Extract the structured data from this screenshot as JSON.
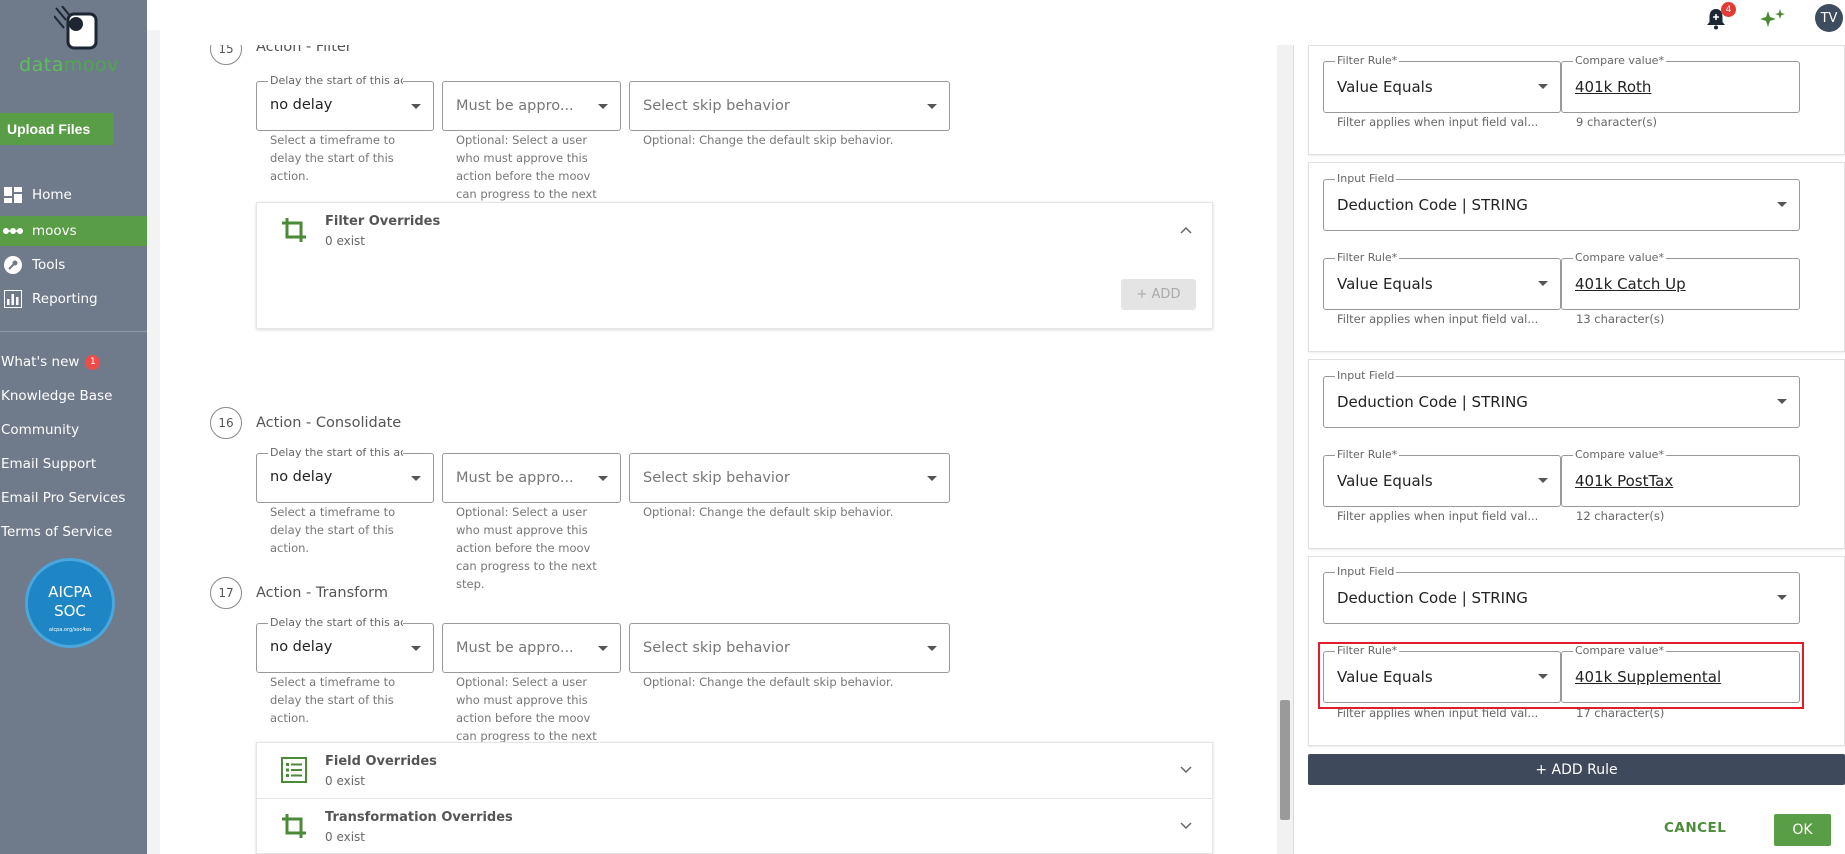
{
  "app": {
    "logo_text_data": "data",
    "logo_text_moov": "moov",
    "upload_label": "Upload Files"
  },
  "sidebar": {
    "nav": [
      {
        "label": "Home",
        "icon": "dashboard-icon"
      },
      {
        "label": "moovs",
        "icon": "moovs-icon"
      },
      {
        "label": "Tools",
        "icon": "wrench-icon"
      },
      {
        "label": "Reporting",
        "icon": "bar-chart-icon"
      }
    ],
    "links": [
      {
        "label": "What's new",
        "badge": "1"
      },
      {
        "label": "Knowledge Base"
      },
      {
        "label": "Community"
      },
      {
        "label": "Email Support"
      },
      {
        "label": "Email Pro Services"
      },
      {
        "label": "Terms of Service"
      }
    ],
    "aicpa": {
      "line1": "AICPA",
      "line2": "SOC",
      "line3": "aicpa.org/soc4so"
    }
  },
  "topbar": {
    "notification_count": "4",
    "avatar_initials": "TV"
  },
  "steps": [
    {
      "number": "15",
      "title": "Action - Filter"
    },
    {
      "number": "16",
      "title": "Action - Consolidate"
    },
    {
      "number": "17",
      "title": "Action - Transform"
    }
  ],
  "fields": {
    "delay_label": "Delay the start of this action",
    "delay_value": "no delay",
    "approver_placeholder": "Must be appro...",
    "skip_placeholder": "Select skip behavior",
    "delay_help": "Select a timeframe to delay the start of this action.",
    "approver_help": "Optional: Select a user who must approve this action before the moov can progress to the next step.",
    "approver_help_short": "Optional: Select a user who must approve this action before the moov can progress to the next",
    "skip_help": "Optional: Change the default skip behavior."
  },
  "panels": {
    "filter_overrides": {
      "title": "Filter Overrides",
      "sub": "0 exist"
    },
    "add_label": "+ ADD",
    "field_overrides": {
      "title": "Field Overrides",
      "sub": "0 exist"
    },
    "transformation_overrides": {
      "title": "Transformation Overrides",
      "sub": "0 exist"
    }
  },
  "rules": {
    "input_field_label": "Input Field",
    "input_field_value": "Deduction Code | STRING",
    "filter_rule_label": "Filter Rule*",
    "filter_rule_value": "Value Equals",
    "compare_label": "Compare value*",
    "filter_help": "Filter applies when input field val...",
    "items": [
      {
        "compare": "401k Roth",
        "chars": "9 character(s)"
      },
      {
        "compare": "401k Catch Up",
        "chars": "13 character(s)"
      },
      {
        "compare": "401k PostTax",
        "chars": "12 character(s)"
      },
      {
        "compare": "401k Supplemental",
        "chars": "17 character(s)"
      }
    ],
    "add_rule": "+ ADD Rule",
    "cancel": "CANCEL",
    "ok": "OK"
  },
  "colors": {
    "sidebar": "#6f7a8b",
    "accent_green": "#5a9d47",
    "highlight_red": "#e11d2b",
    "add_rule_bg": "#3e4a5b"
  }
}
